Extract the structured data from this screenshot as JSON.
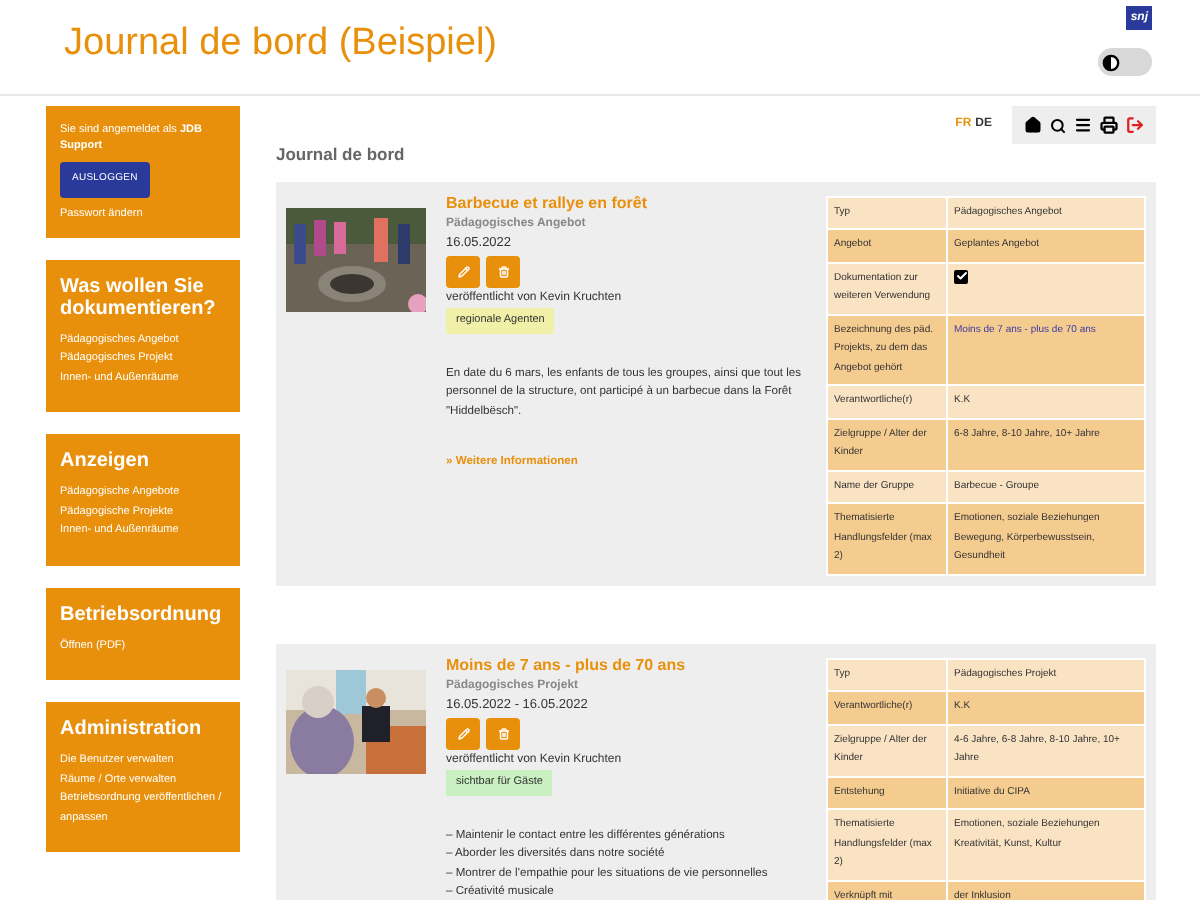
{
  "header": {
    "title": "Journal de bord (Beispiel)",
    "logo": "snj",
    "dark_mode": false
  },
  "sidebar": [
    {
      "kind": "login",
      "text": "Sie sind angemeldet als **JDB Support**",
      "button": "AUSLOGGEN",
      "link": "Passwort ändern"
    },
    {
      "kind": "menu",
      "title": "Was wollen Sie dokumentieren?",
      "links": [
        "Pädagogisches Angebot",
        "Pädagogisches Projekt",
        "Innen- und Außenräume"
      ]
    },
    {
      "kind": "menu",
      "title": "Anzeigen",
      "links": [
        "Pädagogische Angebote",
        "Pädagogische Projekte",
        "Innen- und Außenräume"
      ]
    },
    {
      "kind": "menu",
      "title": "Betriebsordnung",
      "links": [
        "Öffnen (PDF)"
      ]
    },
    {
      "kind": "menu",
      "title": "Administration",
      "links": [
        "Die Benutzer verwalten",
        "Räume / Orte verwalten",
        "Betriebsordnung veröffentlichen / anpassen"
      ]
    }
  ],
  "languages": [
    {
      "label": "FR",
      "selected": true
    },
    {
      "label": "DE",
      "selected": false
    }
  ],
  "page_title": "Journal de bord",
  "entries": [
    {
      "title": "Barbecue et rallye en forêt",
      "category": "Pädagogisches Angebot",
      "date": "16.05.2022",
      "published": "veröffentlicht von Kevin Kruchten",
      "tag": {
        "label": "regionale Agenten",
        "color": "#f0f0a8"
      },
      "description": [
        "En date du 6 mars, les enfants de tous les groupes, ainsi que tout les personnel de la structure, ont participé à un barbecue dans la Forêt \"Hiddelbësch\"."
      ],
      "more_link": "» Weitere Informationen",
      "details": [
        {
          "label": "Typ",
          "kind": "text",
          "value": "Pädagogisches Angebot"
        },
        {
          "label": "Angebot",
          "kind": "text",
          "value": "Geplantes Angebot"
        },
        {
          "label": "Dokumentation zur weiteren Verwendung",
          "kind": "checkbox",
          "checked": true
        },
        {
          "label": "Bezeichnung des päd. Projekts, zu dem das Angebot gehört",
          "kind": "link",
          "value": "Moins de 7 ans - plus de 70 ans"
        },
        {
          "label": "Verantwortliche(r)",
          "kind": "text",
          "value": "K.K"
        },
        {
          "label": "Zielgruppe / Alter der Kinder",
          "kind": "text",
          "value": "6-8 Jahre, 8-10 Jahre, 10+ Jahre"
        },
        {
          "label": "Name der Gruppe",
          "kind": "text",
          "value": "Barbecue - Groupe"
        },
        {
          "label": "Thematisierte Handlungsfelder (max 2)",
          "kind": "text",
          "value": "Emotionen, soziale Beziehungen Bewegung, Körperbewusstsein, Gesundheit"
        }
      ]
    },
    {
      "title": "Moins de 7 ans - plus de 70 ans",
      "category": "Pädagogisches Projekt",
      "date": "16.05.2022 - 16.05.2022",
      "published": "veröffentlicht von Kevin Kruchten",
      "tag": {
        "label": "sichtbar für Gäste",
        "color": "#c8f0c0"
      },
      "description": [
        "– Maintenir le contact entre les différentes générations",
        "– Aborder les diversités dans notre société",
        "– Montrer de l’empathie pour les situations de vie personnelles",
        "– Créativité musicale"
      ],
      "details": [
        {
          "label": "Typ",
          "kind": "text",
          "value": "Pädagogisches Projekt"
        },
        {
          "label": "Verantwortliche(r)",
          "kind": "text",
          "value": "K.K"
        },
        {
          "label": "Zielgruppe / Alter der Kinder",
          "kind": "text",
          "value": "4-6 Jahre, 6-8 Jahre, 8-10 Jahre, 10+ Jahre"
        },
        {
          "label": "Entstehung",
          "kind": "text",
          "value": "Initiative du CIPA"
        },
        {
          "label": "Thematisierte Handlungsfelder (max 2)",
          "kind": "text",
          "value": "Emotionen, soziale Beziehungen Kreativität, Kunst, Kultur"
        },
        {
          "label": "Verknüpft mit",
          "kind": "text",
          "value": "der Inklusion"
        }
      ]
    }
  ]
}
